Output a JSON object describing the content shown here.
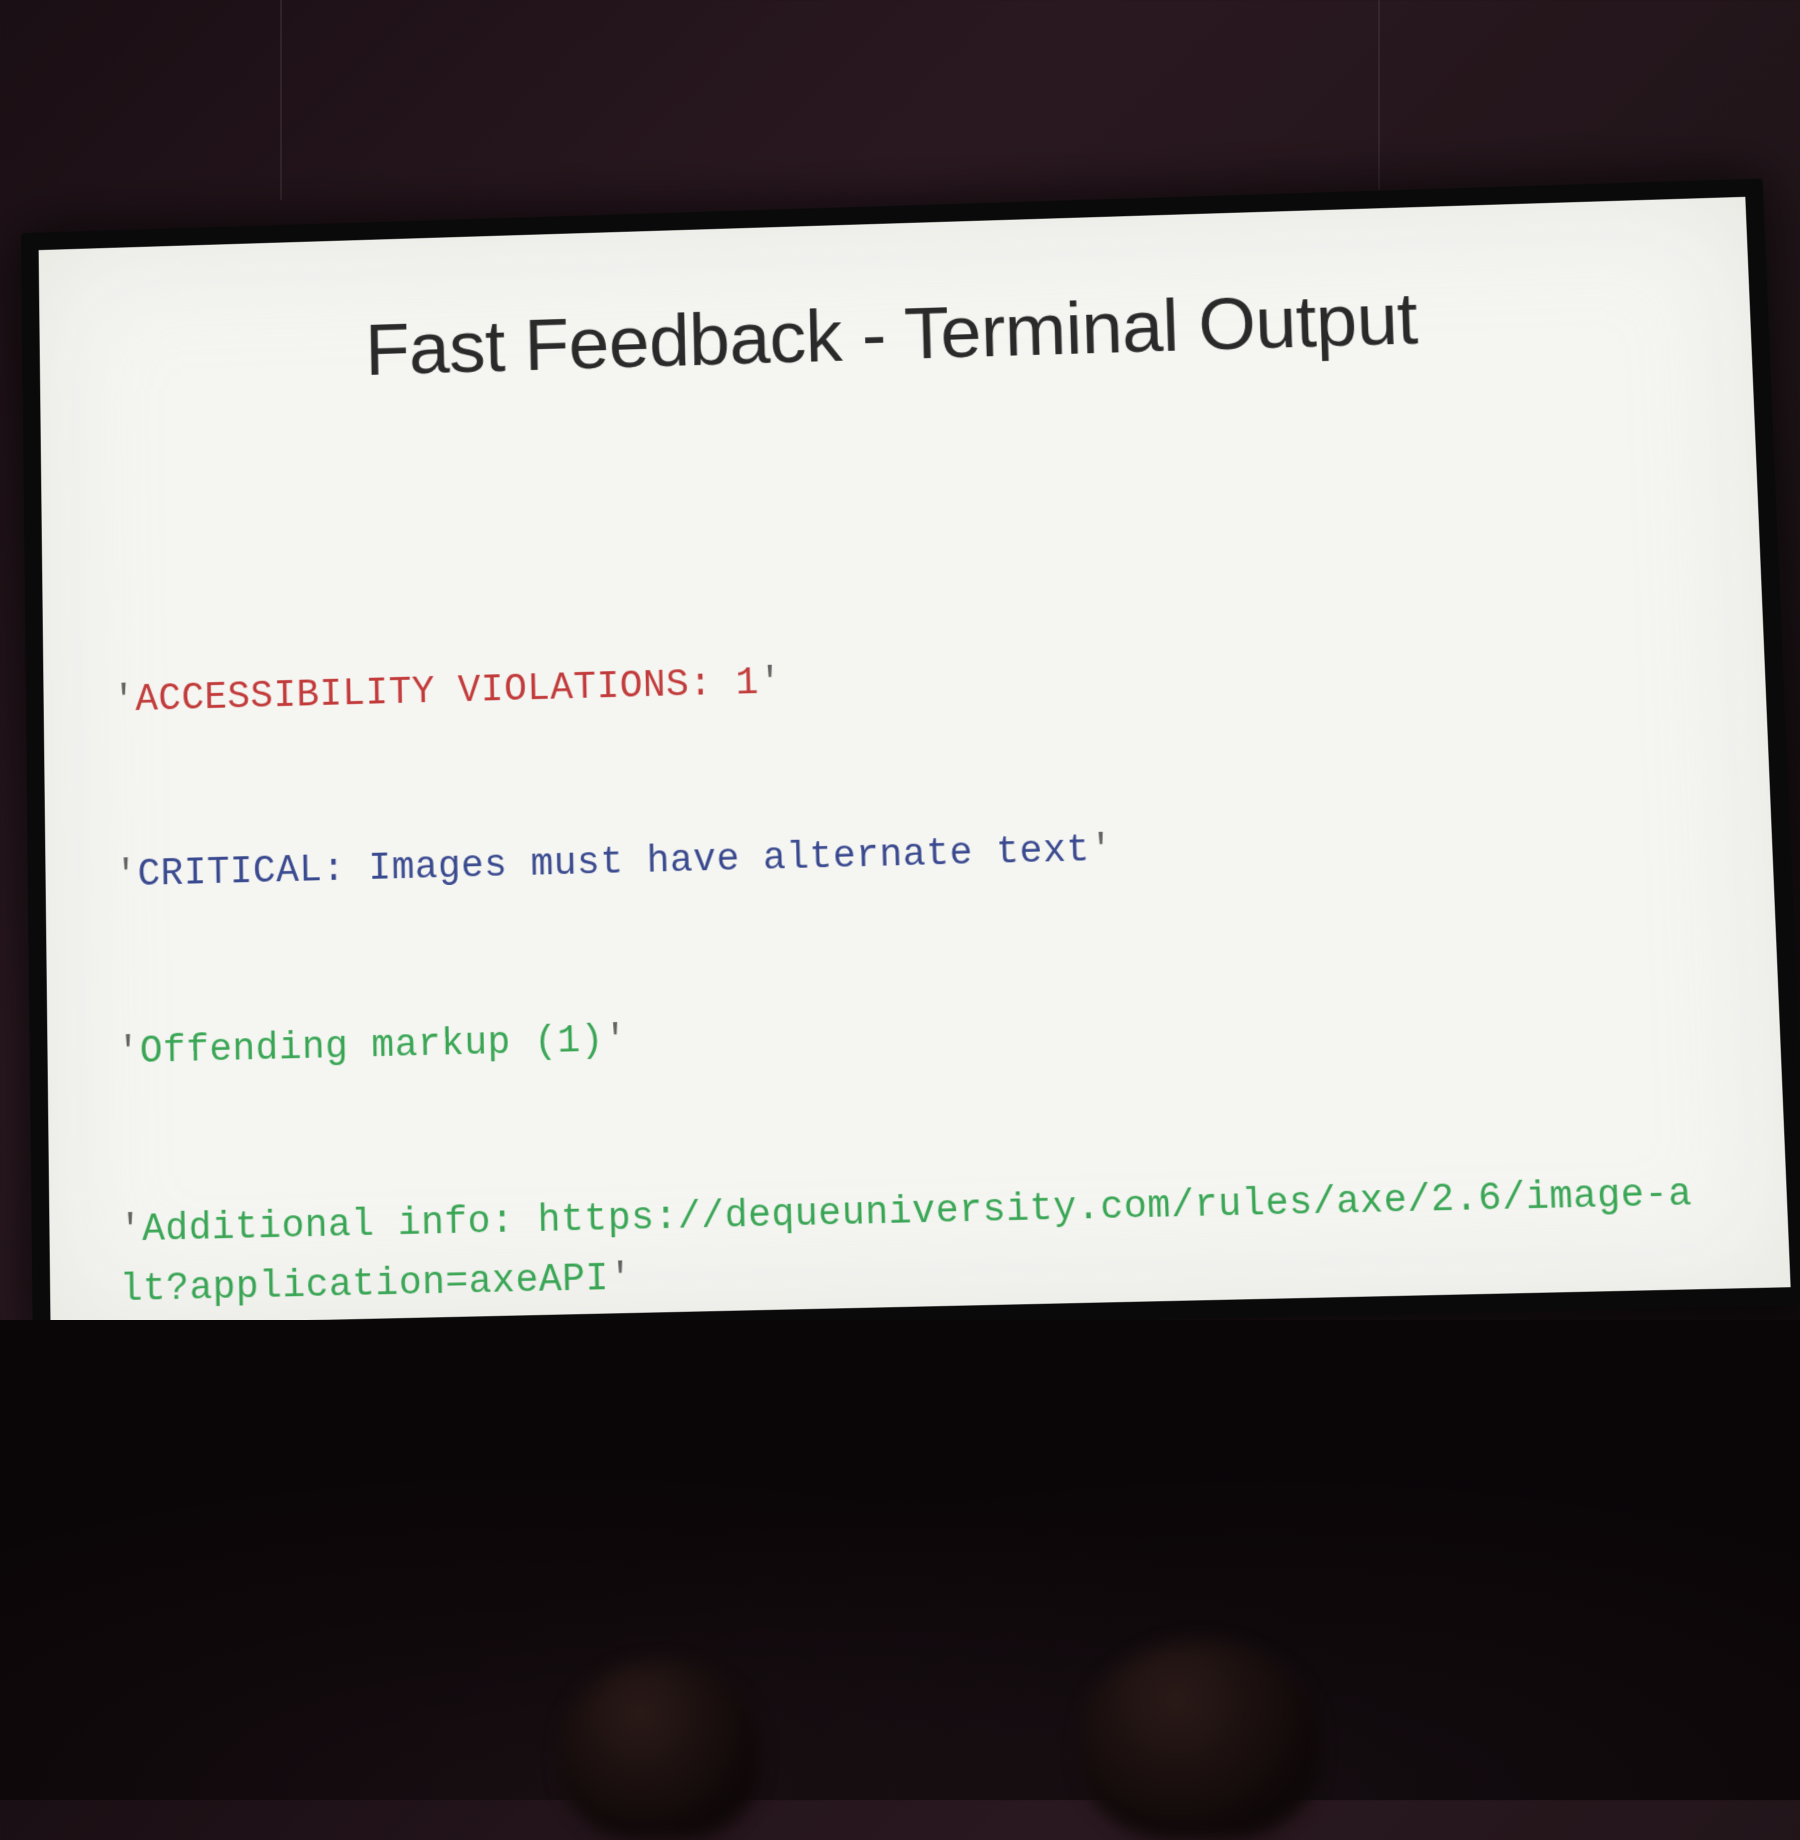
{
  "slide": {
    "title": "Fast Feedback - Terminal Output",
    "terminal": {
      "line1": "ACCESSIBILITY VIOLATIONS: 1",
      "line2": "CRITICAL: Images must have alternate text",
      "line3": "Offending markup (1)",
      "line4": "Additional info: https://dequeuniversity.com/rules/axe/2.6/image-alt?application=axeAPI"
    },
    "colors": {
      "violations": "#c23b3b",
      "critical": "#3a4a8f",
      "info": "#3aa655"
    }
  }
}
